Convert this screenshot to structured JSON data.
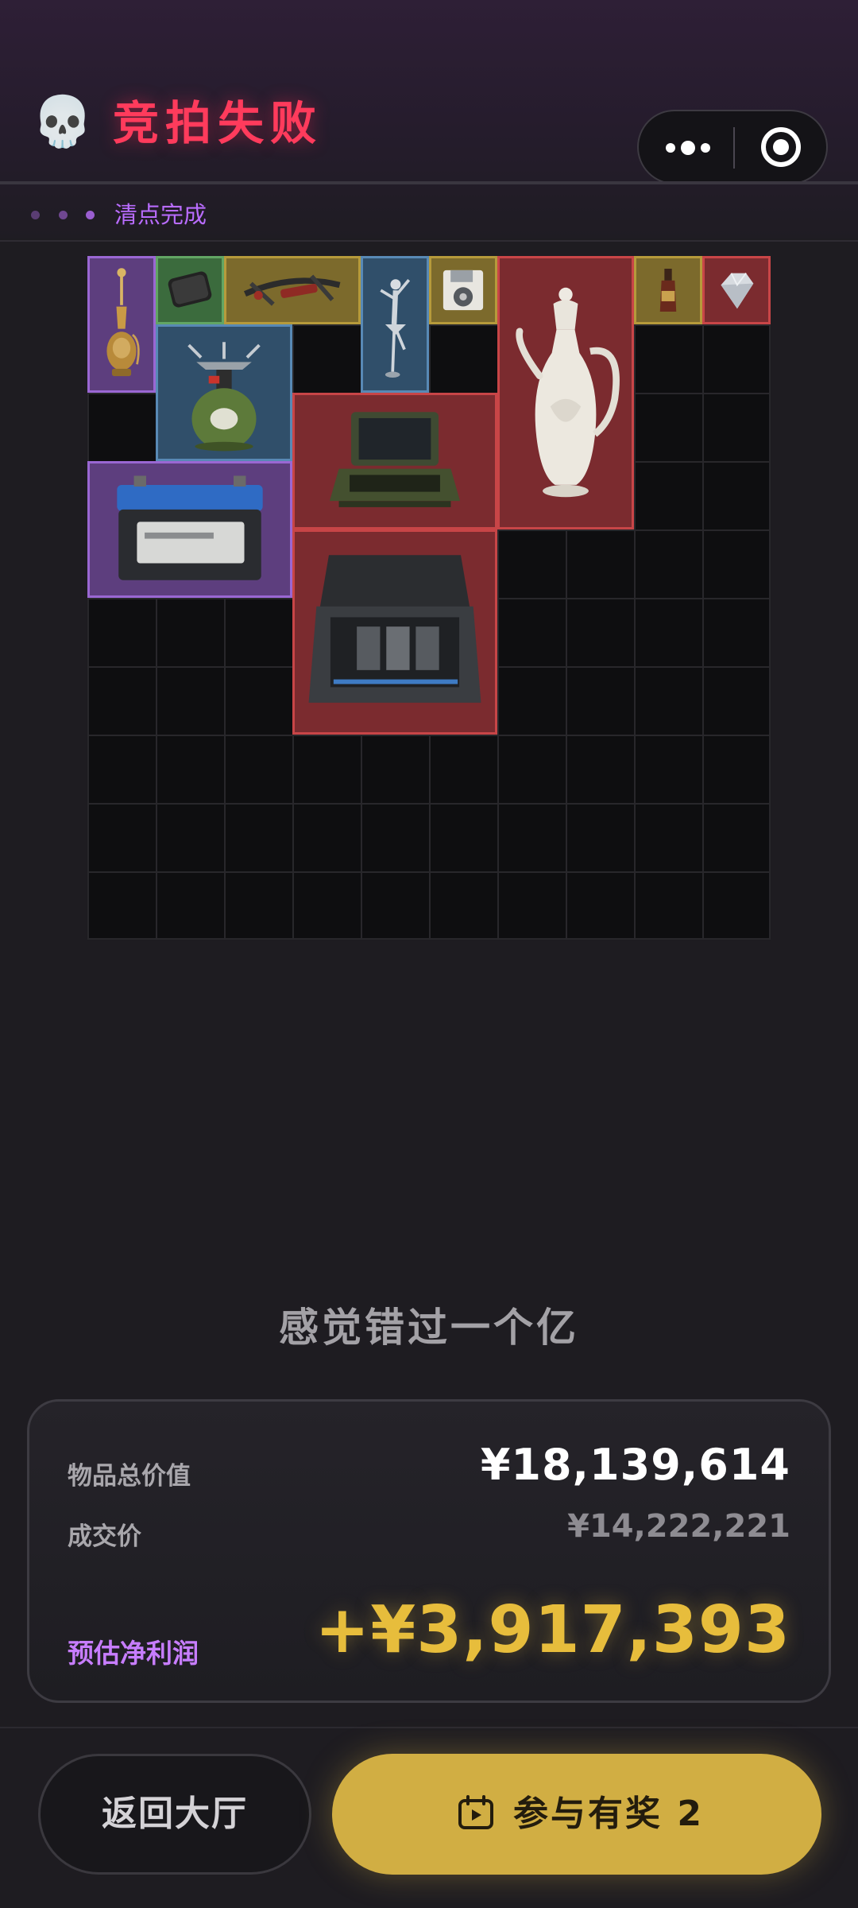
{
  "header": {
    "title": "竞拍失败",
    "skull_icon": "💀",
    "status_text": "清点完成",
    "title_color": "#ff3b5c",
    "status_color": "#b96cff"
  },
  "capsule": {
    "more_icon": "more-dots-icon",
    "close_icon": "target-circle-icon"
  },
  "grid": {
    "rows": 10,
    "columns": 10
  },
  "items": [
    {
      "name": "hookah",
      "rarity": "purple"
    },
    {
      "name": "hard-drive",
      "rarity": "green"
    },
    {
      "name": "crossbow",
      "rarity": "gold"
    },
    {
      "name": "ballerina-figurine",
      "rarity": "blue"
    },
    {
      "name": "floppy-disk",
      "rarity": "gold"
    },
    {
      "name": "porcelain-ewer",
      "rarity": "red"
    },
    {
      "name": "bottle",
      "rarity": "gold"
    },
    {
      "name": "diamond",
      "rarity": "red"
    },
    {
      "name": "camping-stove",
      "rarity": "blue"
    },
    {
      "name": "rugged-laptop",
      "rarity": "red"
    },
    {
      "name": "car-battery",
      "rarity": "purple"
    },
    {
      "name": "equipment-case",
      "rarity": "red"
    }
  ],
  "quote": "感觉错过一个亿",
  "summary": {
    "total_label": "物品总价值",
    "total_value": "¥18,139,614",
    "deal_label": "成交价",
    "deal_value": "¥14,222,221",
    "profit_label": "预估净利润",
    "profit_value": "+¥3,917,393",
    "profit_color": "#e7bd3c"
  },
  "buttons": {
    "back_label": "返回大厅",
    "join_label": "参与有奖 2",
    "join_icon": "calendar-play-icon",
    "join_color": "#d1ae43"
  }
}
